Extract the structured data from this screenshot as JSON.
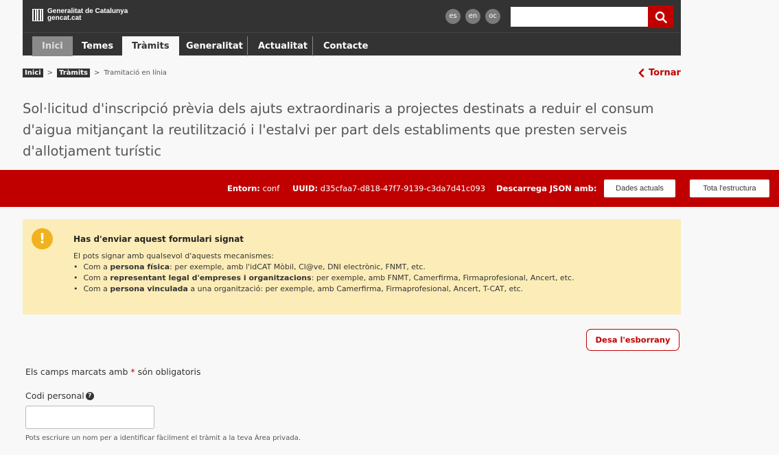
{
  "header": {
    "brand_line1": "Generalitat de Catalunya",
    "brand_line2": "gencat.cat",
    "languages": [
      "es",
      "en",
      "oc"
    ],
    "search_placeholder": ""
  },
  "nav": {
    "items": [
      "Inici",
      "Temes",
      "Tràmits",
      "Generalitat",
      "Actualitat",
      "Contacte"
    ],
    "active": "Tràmits"
  },
  "breadcrumb": {
    "items": [
      "Inici",
      "Tràmits"
    ],
    "current": "Tramitació en línia",
    "separator": ">"
  },
  "back_label": "Tornar",
  "page_title": "Sol·licitud d'inscripció prèvia dels ajuts extraordinaris a projectes destinats a reduir el consum d'aigua mitjançant la reutilització i l'estalvi per part dels establiments que presten serveis d'allotjament turístic",
  "env_bar": {
    "entorn_label": "Entorn:",
    "entorn_value": "conf",
    "uuid_label": "UUID:",
    "uuid_value": "d35cfaa7-d818-47f7-9139-c3da7d41c093",
    "download_label": "Descarrega JSON amb:",
    "btn_current": "Dades actuals",
    "btn_structure": "Tota l'estructura"
  },
  "warning": {
    "title": "Has d'enviar aquest formulari signat",
    "intro": "El pots signar amb qualsevol d'aquests mecanismes:",
    "items": [
      {
        "pre": "Com a ",
        "bold": "persona física",
        "post": ": per exemple, amb l'idCAT Mòbil, Cl@ve, DNI electrònic, FNMT, etc."
      },
      {
        "pre": "Com a ",
        "bold": "representant legal d'empreses i organitzacions",
        "post": ": per exemple, amb FNMT, Camerfirma, Firmaprofesional, Ancert, etc."
      },
      {
        "pre": "Com a ",
        "bold": "persona vinculada",
        "post": " a una organització: per exemple, amb Camerfirma, Firmaprofesional, Ancert, T-CAT, etc."
      }
    ]
  },
  "draft_button": "Desa l'esborrany",
  "form": {
    "required_note_pre": "Els camps marcats amb",
    "required_star": "*",
    "required_note_post": "són obligatoris",
    "field_label": "Codi personal",
    "field_value": "",
    "field_help": "Pots escriure un nom per a identificar fàcilment el tràmit a la teva Àrea privada."
  },
  "colors": {
    "brand_red": "#c00000",
    "header_dark": "#333333",
    "warning_bg": "#fcedb8",
    "warning_icon": "#f0b21e"
  }
}
